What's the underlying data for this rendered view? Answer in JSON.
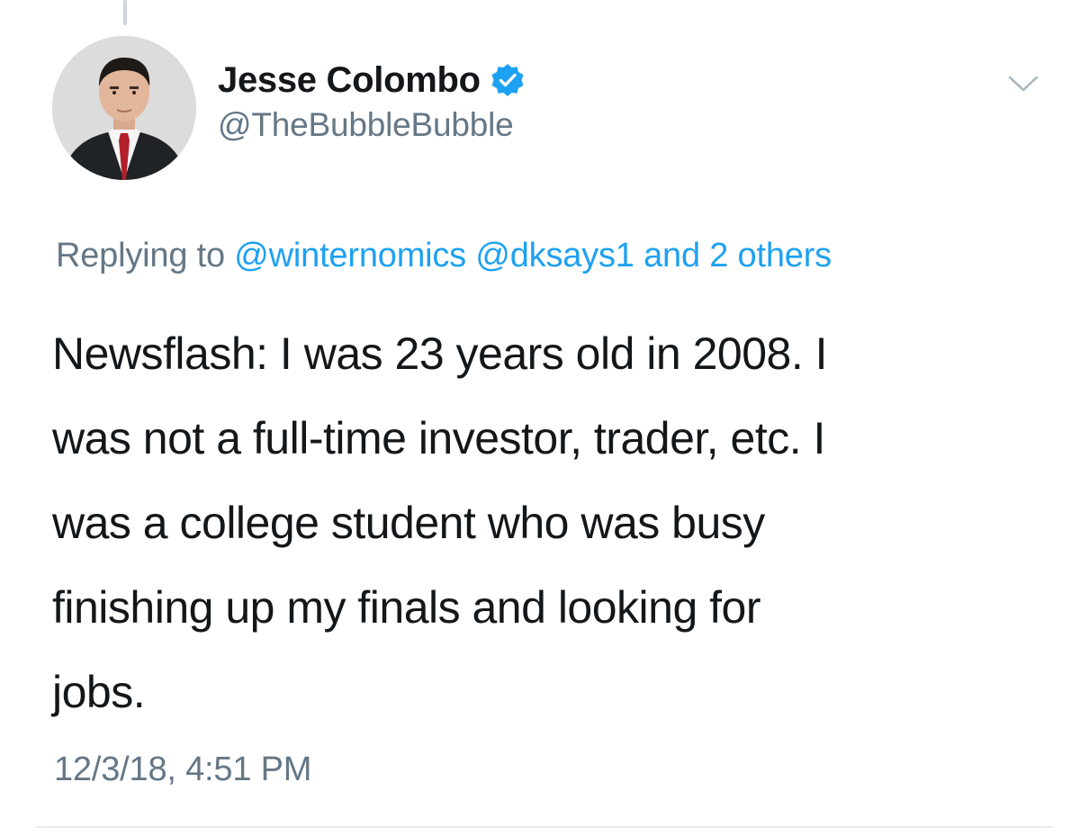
{
  "tweet": {
    "author": {
      "display_name": "Jesse Colombo",
      "handle": "@TheBubbleBubble",
      "verified": true,
      "avatar_icon": "profile-photo"
    },
    "menu_icon": "chevron-down-icon",
    "reply_context": {
      "prefix": "Replying to",
      "mentions": [
        "@winternomics",
        "@dksays1"
      ],
      "others_text": "and 2 others"
    },
    "text_lines": [
      "Newsflash: I was 23 years old in 2008. I",
      "was not a full-time investor, trader, etc. I",
      "was a college student who was busy",
      "finishing up my finals and looking for",
      "jobs."
    ],
    "timestamp": "12/3/18, 4:51 PM"
  },
  "colors": {
    "text_primary": "#14171a",
    "text_secondary": "#657786",
    "link": "#1da1f2",
    "verified_badge": "#1da1f2",
    "divider": "#e6ecf0"
  }
}
